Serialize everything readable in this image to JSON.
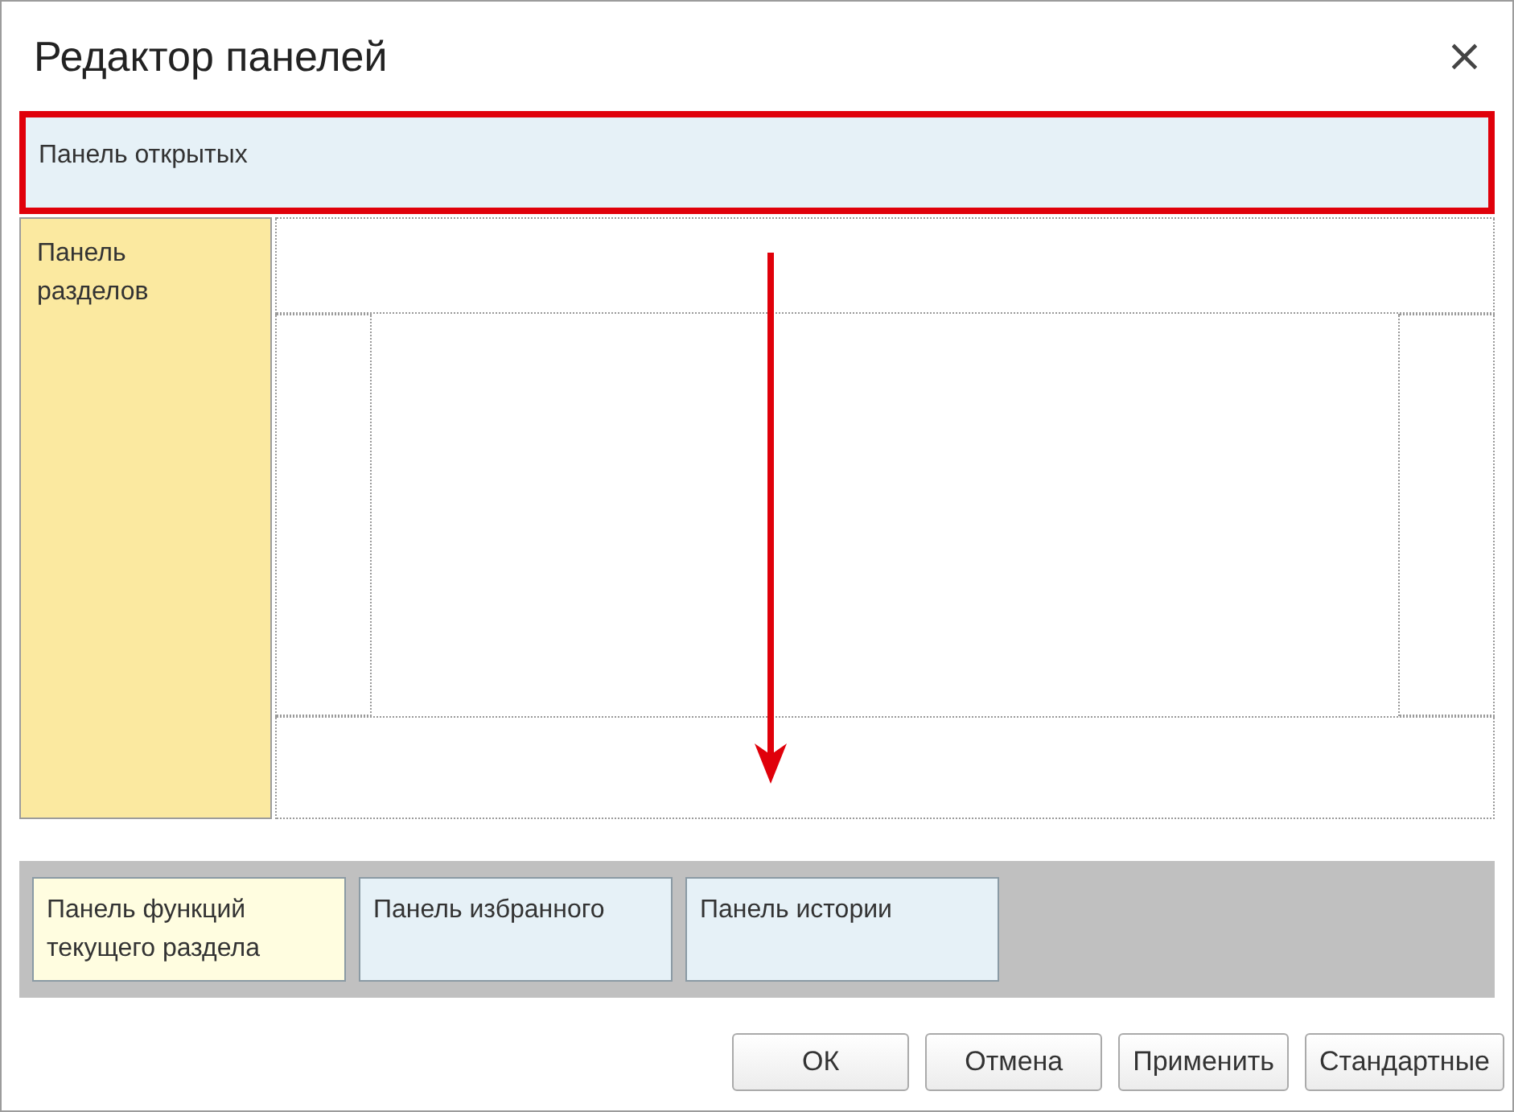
{
  "window": {
    "title": "Редактор панелей",
    "close": "×"
  },
  "top_panel": {
    "label": "Панель открытых",
    "highlighted": true
  },
  "side_panel": {
    "label": "Панель разделов"
  },
  "arrow": {
    "shown": true
  },
  "available_panels": [
    {
      "label": "Панель функций текущего раздела",
      "color": "#fffde0"
    },
    {
      "label": "Панель избранного",
      "color": "#e6f1f7"
    },
    {
      "label": "Панель истории",
      "color": "#e6f1f7"
    }
  ],
  "buttons": [
    "ОК",
    "Отмена",
    "Применить",
    "Стандартные"
  ]
}
